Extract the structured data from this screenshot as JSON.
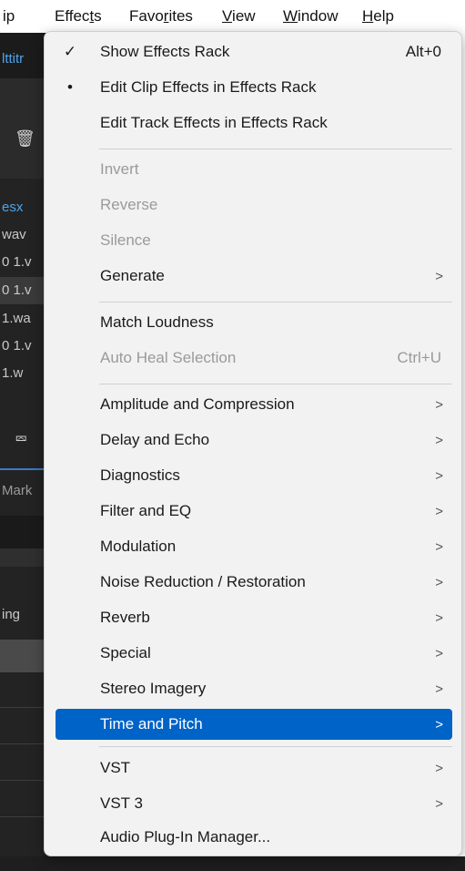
{
  "menubar": {
    "items": [
      {
        "label": "ip"
      },
      {
        "pre": "Effec",
        "ul": "t",
        "post": "s"
      },
      {
        "pre": "Favo",
        "ul": "r",
        "post": "ites"
      },
      {
        "pre": "",
        "ul": "V",
        "post": "iew"
      },
      {
        "pre": "",
        "ul": "W",
        "post": "indow"
      },
      {
        "pre": "",
        "ul": "H",
        "post": "elp"
      }
    ]
  },
  "background_fragments": [
    "lttitr",
    "esx",
    "wav",
    "0 1.v",
    "0 1.v",
    "1.wa",
    "0 1.v",
    "1.w",
    "Mark",
    "ing"
  ],
  "effects_menu": {
    "show_effects_rack": {
      "label": "Show Effects Rack",
      "shortcut": "Alt+0",
      "check": "✓"
    },
    "edit_clip_effects": {
      "label": "Edit Clip Effects in Effects Rack",
      "bullet": "•"
    },
    "edit_track_effects": {
      "label": "Edit Track Effects in Effects Rack"
    },
    "invert": {
      "label": "Invert"
    },
    "reverse": {
      "label": "Reverse"
    },
    "silence": {
      "label": "Silence"
    },
    "generate": {
      "label": "Generate"
    },
    "match_loudness": {
      "label": "Match Loudness"
    },
    "auto_heal": {
      "label": "Auto Heal Selection",
      "shortcut": "Ctrl+U"
    },
    "amplitude": {
      "label": "Amplitude and Compression"
    },
    "delay": {
      "label": "Delay and Echo"
    },
    "diagnostics": {
      "label": "Diagnostics"
    },
    "filter": {
      "label": "Filter and EQ"
    },
    "modulation": {
      "label": "Modulation"
    },
    "noise": {
      "label": "Noise Reduction / Restoration"
    },
    "reverb": {
      "label": "Reverb"
    },
    "special": {
      "label": "Special"
    },
    "stereo": {
      "label": "Stereo Imagery"
    },
    "time_pitch": {
      "label": "Time and Pitch"
    },
    "vst": {
      "label": "VST"
    },
    "vst3": {
      "label": "VST 3"
    },
    "plugin_manager": {
      "label": "Audio Plug-In Manager..."
    }
  },
  "icons": {
    "submenu": "chevron-right-icon",
    "check": "checkmark-icon",
    "bullet": "bullet-icon",
    "trash": "trash-icon",
    "export": "export-icon"
  },
  "colors": {
    "selected_bg": "#0063c7",
    "menu_bg": "#f2f2f2",
    "disabled_text": "#9a9a9a",
    "app_bg": "#232323",
    "accent_text": "#4fa3e8"
  }
}
